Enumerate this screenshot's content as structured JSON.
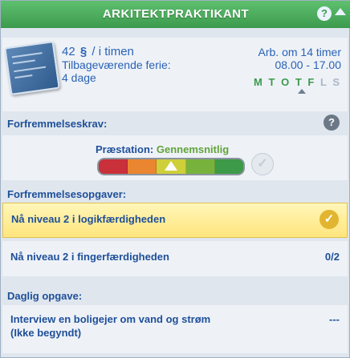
{
  "window": {
    "title": "ARKITEKTPRAKTIKANT",
    "help_icon": "?"
  },
  "job": {
    "pay_value": "42",
    "pay_currency_symbol": "§",
    "pay_unit": "/ i timen",
    "vacation_label": "Tilbageværende ferie:",
    "vacation_value": "4 dage",
    "work_in": "Arb. om 14 timer",
    "hours": "08.00 - 17.00",
    "days": [
      {
        "label": "M",
        "active": true
      },
      {
        "label": "T",
        "active": true
      },
      {
        "label": "O",
        "active": true
      },
      {
        "label": "T",
        "active": true
      },
      {
        "label": "F",
        "active": true
      },
      {
        "label": "L",
        "active": false
      },
      {
        "label": "S",
        "active": false
      }
    ]
  },
  "promotion_requirements": {
    "header": "Forfremmelseskrav:",
    "help_icon": "?",
    "performance_label": "Præstation:",
    "performance_value": "Gennemsnitlig",
    "performance_level": 0.5
  },
  "promotion_tasks": {
    "header": "Forfremmelsesopgaver:",
    "items": [
      {
        "text": "Nå niveau 2 i logikfærdigheden",
        "status": "complete",
        "value": ""
      },
      {
        "text": "Nå niveau 2 i fingerfærdigheden",
        "status": "progress",
        "value": "0/2"
      }
    ]
  },
  "daily_task": {
    "header": "Daglig opgave:",
    "line1": "Interview en boligejer om vand og strøm",
    "line2": "(Ikke begyndt)",
    "value": "---"
  },
  "colors": {
    "title_bar": "#3c9a4c",
    "text_blue": "#2a62b5",
    "active_day": "#3c9a4c",
    "performance": "#62a33b",
    "done_highlight": "#ffe57e"
  }
}
